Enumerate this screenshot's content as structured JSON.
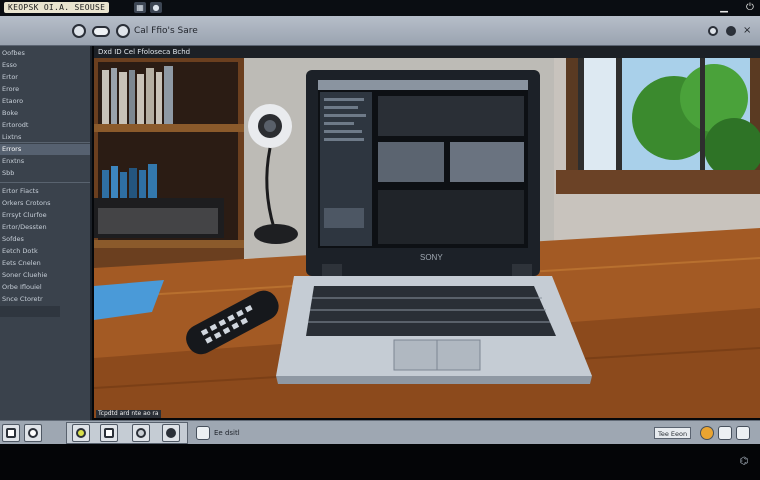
{
  "window": {
    "title": "KEOPSK OI.A. SEOUSE",
    "title_icons": [
      "grid-icon",
      "record-icon"
    ],
    "controls": [
      "minimize",
      "close"
    ]
  },
  "toolbar": {
    "label": "Cal Ffio's Sare",
    "icons": [
      "back-icon",
      "forward-icon",
      "pill-icon",
      "refresh-icon",
      "settings-icon",
      "close-icon"
    ]
  },
  "viewer": {
    "caption": "Dxd ID Cel Ffoloseca Bchd",
    "image_caption": "Tcpdtd ard nte ao ra"
  },
  "sidebar": {
    "items": [
      "Oofbes",
      "Esso",
      "Ertor",
      "Erore",
      "Etaoro",
      "Boke",
      "Ertorodt",
      "Lixtns",
      "Errors",
      "Enxtns",
      "Sbb",
      "Ertor Fiacts",
      "Orkers Crotons",
      "Errsyt Clurfoe",
      "Ertor/Dessten",
      "Sofdes",
      "Eetch Dotk",
      "Eets Cnelen",
      "Soner Cluehie",
      "Orbe Iflouiel",
      "Snce Ctoretr"
    ],
    "selected_index": 9
  },
  "statusbar": {
    "left_buttons": [
      "info-icon",
      "record-icon",
      "eye-icon",
      "monitor-icon",
      "swirl-icon",
      "disc-icon"
    ],
    "text": "Ee dsitl",
    "right_badge": "Tee Eeon",
    "right_icons": [
      "warning-icon",
      "gear-icon",
      "share-icon"
    ]
  },
  "colors": {
    "toolbar": "#a8b0bb",
    "sidebar": "#3a424c",
    "statusbar": "#9ea7b2",
    "background": "#05070a"
  }
}
